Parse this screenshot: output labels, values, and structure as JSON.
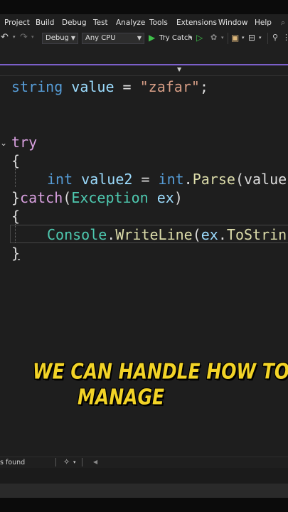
{
  "menu": {
    "items": [
      "Project",
      "Build",
      "Debug",
      "Test",
      "Analyze",
      "Tools",
      "Extensions",
      "Window",
      "Help"
    ]
  },
  "toolbar": {
    "config": "Debug",
    "platform": "Any CPU",
    "run_target": "Try Catch"
  },
  "code": {
    "line1": {
      "kw": "string",
      "var": "value",
      "eq": " = ",
      "str": "\"zafar\"",
      "end": ";"
    },
    "line2": {
      "kw": "try"
    },
    "line3": {
      "brace": "{"
    },
    "line4": {
      "kw": "int",
      "var": "value2",
      "eq": " = ",
      "kw2": "int",
      "dot": ".",
      "fn": "Parse",
      "rest": "(value"
    },
    "line5": {
      "brace": "}",
      "kw": "catch",
      "open": "(",
      "type": "Exception",
      "var": " ex",
      "close": ")"
    },
    "line6": {
      "brace": "{"
    },
    "line7": {
      "type": "Console",
      "dot": ".",
      "fn": "WriteLine",
      "open": "(",
      "var": "ex",
      "dot2": ".",
      "fn2": "ToStrin"
    },
    "line8": {
      "brace": "}"
    }
  },
  "caption": {
    "line1": "WE CAN HANDLE HOW TO",
    "line2": "MANAGE"
  },
  "status": {
    "issues": "s found"
  },
  "colors": {
    "accent": "#7b5fc9",
    "caption": "#f2d327",
    "keyword": "#569cd6",
    "control": "#d8a0df",
    "string": "#d69d85",
    "type": "#4ec9b0"
  }
}
